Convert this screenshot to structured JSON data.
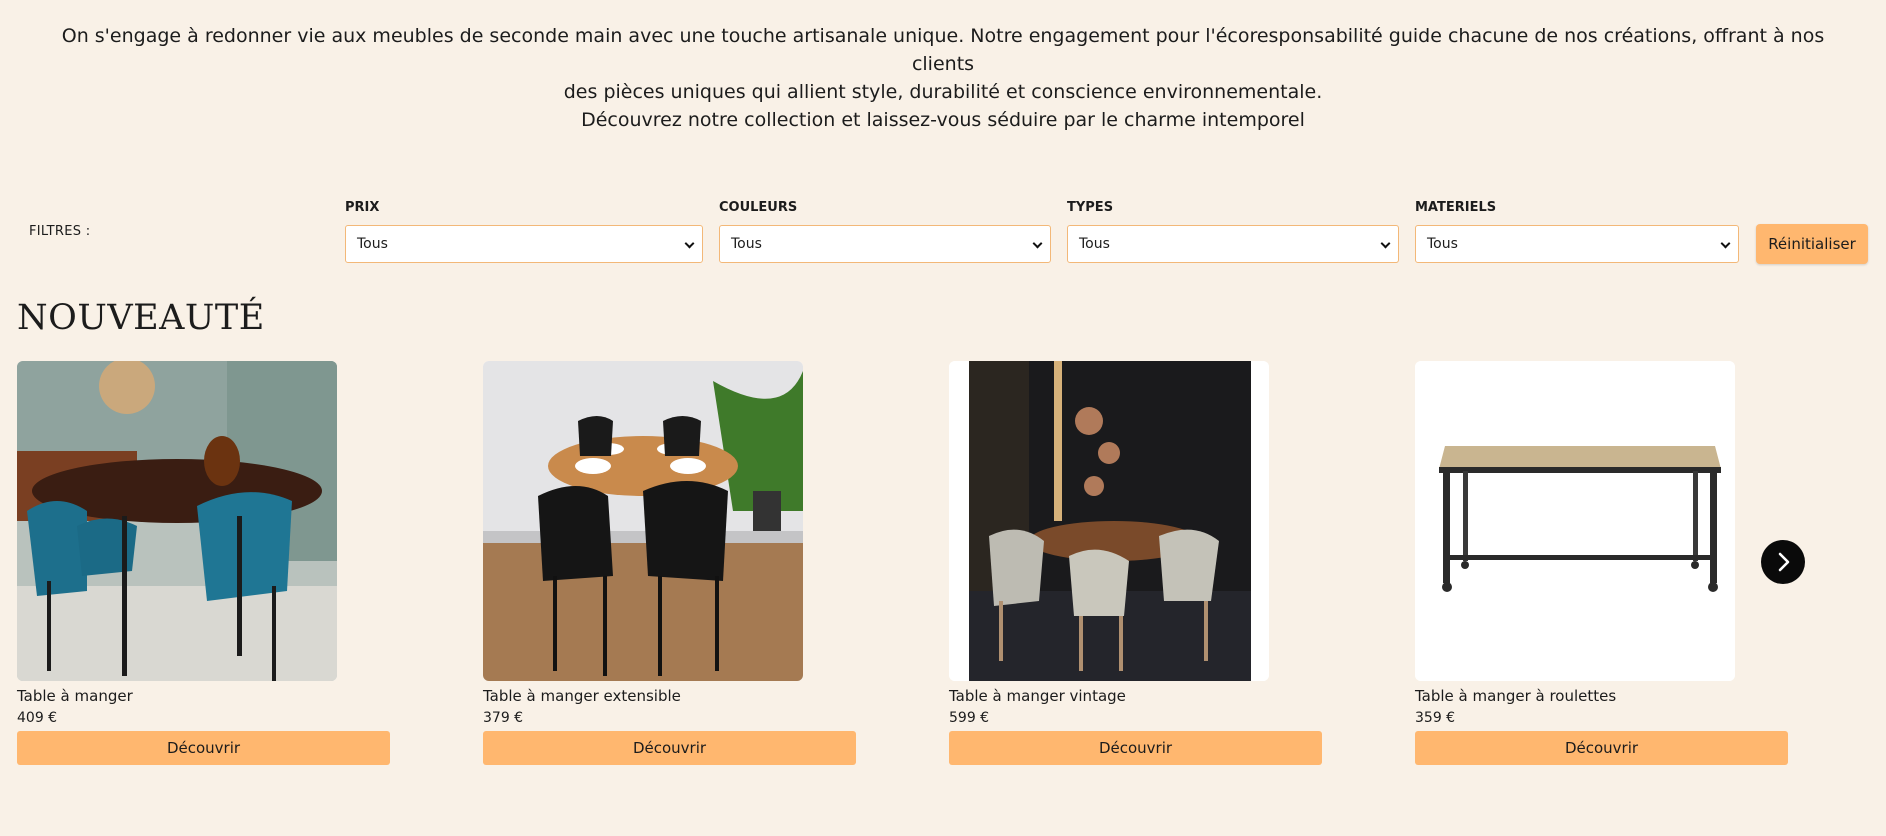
{
  "intro": {
    "line1": "On s'engage à redonner vie aux meubles de seconde main avec une touche artisanale unique. Notre engagement pour l'écoresponsabilité guide chacune de nos créations, offrant à nos clients",
    "line2": "des pièces uniques qui allient style, durabilité et conscience environnementale.",
    "line3": "Découvrez notre collection et laissez-vous séduire par le charme intemporel"
  },
  "filters": {
    "label": "FILTRES :",
    "prix": {
      "label": "PRIX",
      "value": "Tous"
    },
    "couleurs": {
      "label": "COULEURS",
      "value": "Tous"
    },
    "types": {
      "label": "TYPES",
      "value": "Tous"
    },
    "materiels": {
      "label": "MATERIELS",
      "value": "Tous"
    },
    "reset_label": "Réinitialiser"
  },
  "section": {
    "title": "NOUVEAUTÉ"
  },
  "products": [
    {
      "name": "Table à manger",
      "price": "409 €",
      "cta": "Découvrir"
    },
    {
      "name": "Table à manger extensible",
      "price": "379 €",
      "cta": "Découvrir"
    },
    {
      "name": "Table à manger vintage",
      "price": "599 €",
      "cta": "Découvrir"
    },
    {
      "name": "Table à manger à roulettes",
      "price": "359 €",
      "cta": "Découvrir"
    }
  ],
  "carousel": {
    "next_icon": "chevron-right-icon"
  },
  "colors": {
    "background": "#f9f1e7",
    "accent": "#ffb76f",
    "select_border": "#f3b878"
  }
}
